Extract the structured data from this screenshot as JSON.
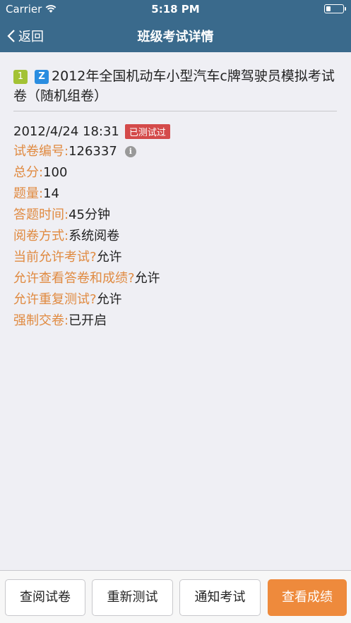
{
  "status_bar": {
    "carrier": "Carrier",
    "time": "5:18 PM"
  },
  "nav": {
    "back_label": "返回",
    "title": "班级考试详情"
  },
  "exam": {
    "index_badge": "1",
    "type_badge": "Z",
    "title": "2012年全国机动车小型汽车c牌驾驶员模拟考试卷（随机组卷）",
    "datetime": "2012/4/24 18:31",
    "status_tag": "已测试过"
  },
  "details": [
    {
      "label": "试卷编号:",
      "value": "126337"
    },
    {
      "label": "总分:",
      "value": "100"
    },
    {
      "label": "题量:",
      "value": "14"
    },
    {
      "label": "答题时间:",
      "value": "45分钟"
    },
    {
      "label": "阅卷方式:",
      "value": "系统阅卷"
    },
    {
      "label": "当前允许考试?",
      "value": "允许"
    },
    {
      "label": "允许查看答卷和成绩?",
      "value": "允许"
    },
    {
      "label": "允许重复测试?",
      "value": "允许"
    },
    {
      "label": "强制交卷:",
      "value": "已开启"
    }
  ],
  "buttons": {
    "review": "查阅试卷",
    "retest": "重新测试",
    "notify": "通知考试",
    "score": "查看成绩"
  },
  "colors": {
    "nav_bg": "#3a6a8c",
    "label": "#e08a40",
    "tag": "#d44a4a",
    "primary_button": "#ee8a3c"
  }
}
